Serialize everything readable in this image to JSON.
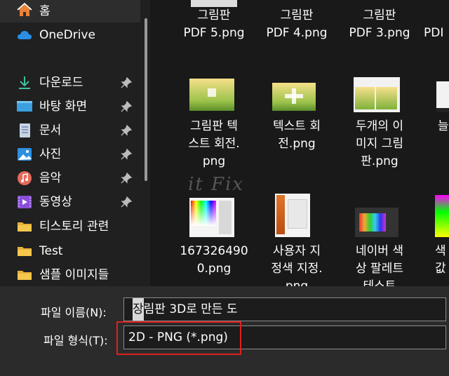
{
  "sidebar": {
    "home": {
      "label": "홈",
      "icon": "home-icon"
    },
    "onedrive": {
      "label": "OneDrive",
      "icon": "cloud-icon"
    },
    "items": [
      {
        "label": "다운로드",
        "icon": "download-icon",
        "pinned": true
      },
      {
        "label": "바탕 화면",
        "icon": "desktop-icon",
        "pinned": true
      },
      {
        "label": "문서",
        "icon": "document-icon",
        "pinned": true
      },
      {
        "label": "사진",
        "icon": "pictures-icon",
        "pinned": true
      },
      {
        "label": "음악",
        "icon": "music-icon",
        "pinned": true
      },
      {
        "label": "동영상",
        "icon": "video-icon",
        "pinned": true
      },
      {
        "label": "티스토리 관련",
        "icon": "folder-icon",
        "pinned": false
      },
      {
        "label": "Test",
        "icon": "folder-icon",
        "pinned": false
      },
      {
        "label": "샘플 이미지들",
        "icon": "folder-icon",
        "pinned": false
      }
    ]
  },
  "files": {
    "row1": [
      {
        "line1": "그림판",
        "line2": "PDF 5.png"
      },
      {
        "line1": "그림판",
        "line2": "PDF 4.png"
      },
      {
        "line1": "그림판",
        "line2": "PDF 3.png"
      },
      {
        "line1": "",
        "line2": "PDI"
      }
    ],
    "row2": [
      {
        "line1": "그림판 텍",
        "line2": "스트 회전.",
        "line3": "png"
      },
      {
        "line1": "텍스트 회",
        "line2": "전.png",
        "line3": ""
      },
      {
        "line1": "두개의 이",
        "line2": "미지 그림",
        "line3": "판.png"
      },
      {
        "line1": "늘",
        "line2": "",
        "line3": ""
      }
    ],
    "row3": [
      {
        "line1": "167326490",
        "line2": "0.png",
        "line3": ""
      },
      {
        "line1": "사용자 지",
        "line2": "정색 지정.",
        "line3": "png"
      },
      {
        "line1": "네이버 색",
        "line2": "상 팔레트",
        "line3": "테스트"
      },
      {
        "line1": "색",
        "line2": "값",
        "line3": ""
      }
    ]
  },
  "watermark": "it Fix",
  "bottom": {
    "filename_label": "파일 이름(N):",
    "filename_value_before": "그림판 3D로 만든 도",
    "filename_value_selected": "장",
    "filetype_label": "파일 형식(T):",
    "filetype_value": "2D - PNG (*.png)"
  },
  "colors": {
    "highlight": "#e0201e",
    "accent": "#0078d4"
  }
}
